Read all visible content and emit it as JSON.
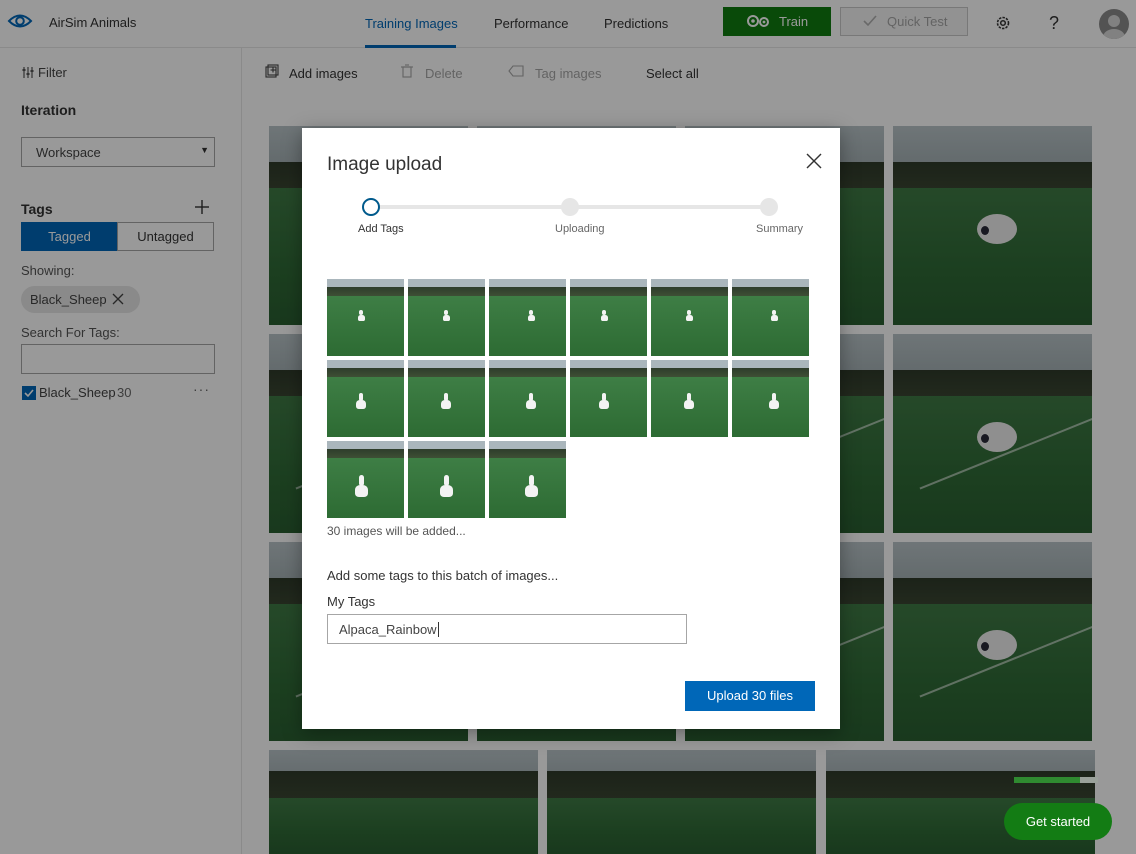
{
  "header": {
    "project_name": "AirSim Animals",
    "tabs": [
      {
        "label": "Training Images",
        "active": true
      },
      {
        "label": "Performance",
        "active": false
      },
      {
        "label": "Predictions",
        "active": false
      }
    ],
    "train_label": "Train",
    "quick_test_label": "Quick Test",
    "icons": [
      "eye-icon",
      "gears-icon",
      "check-icon",
      "settings-icon",
      "help-icon",
      "user-avatar-icon"
    ]
  },
  "sidebar": {
    "filter_label": "Filter",
    "iteration_heading": "Iteration",
    "iteration_selected": "Workspace",
    "tags_heading": "Tags",
    "tagged_label": "Tagged",
    "untagged_label": "Untagged",
    "showing_label": "Showing:",
    "showing_chip": "Black_Sheep",
    "search_label": "Search For Tags:",
    "search_value": "",
    "tags": [
      {
        "name": "Black_Sheep",
        "count": "30",
        "checked": true,
        "more": "···"
      }
    ]
  },
  "toolbar": {
    "add_images": "Add images",
    "delete": "Delete",
    "tag_images": "Tag images",
    "select_all": "Select all"
  },
  "modal": {
    "title": "Image upload",
    "steps": [
      {
        "label": "Add Tags",
        "current": true
      },
      {
        "label": "Uploading",
        "current": false
      },
      {
        "label": "Summary",
        "current": false
      }
    ],
    "thumbnail_count": 15,
    "images_added_text": "30 images will be added...",
    "batch_prompt": "Add some tags to this batch of images...",
    "my_tags_label": "My Tags",
    "my_tags_value": "Alpaca_Rainbow",
    "upload_button": "Upload 30 files"
  },
  "get_started": {
    "label": "Get started",
    "progress": 0.78
  },
  "colors": {
    "accent": "#0067b8",
    "train_green": "#107c10",
    "get_started_green": "#137c14"
  }
}
